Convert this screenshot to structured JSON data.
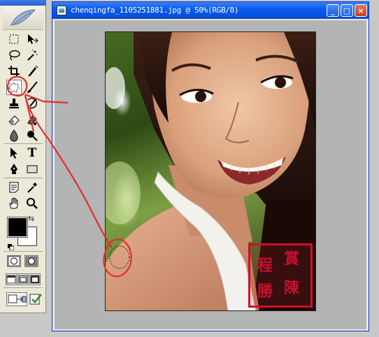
{
  "toolbox": {
    "tools": [
      {
        "name": "marquee-tool",
        "icon": "marquee-icon"
      },
      {
        "name": "move-tool",
        "icon": "move-icon"
      },
      {
        "name": "lasso-tool",
        "icon": "lasso-icon"
      },
      {
        "name": "magic-wand-tool",
        "icon": "magic-wand-icon"
      },
      {
        "name": "crop-tool",
        "icon": "crop-icon"
      },
      {
        "name": "slice-tool",
        "icon": "slice-icon"
      },
      {
        "name": "healing-tool",
        "icon": "healing-brush-icon"
      },
      {
        "name": "brush-tool",
        "icon": "brush-icon"
      },
      {
        "name": "clone-stamp-tool",
        "icon": "clone-stamp-icon"
      },
      {
        "name": "history-brush-tool",
        "icon": "history-brush-icon"
      },
      {
        "name": "eraser-tool",
        "icon": "eraser-icon"
      },
      {
        "name": "gradient-tool",
        "icon": "gradient-icon"
      },
      {
        "name": "blur-tool",
        "icon": "blur-icon"
      },
      {
        "name": "dodge-tool",
        "icon": "dodge-icon"
      },
      {
        "name": "path-selection-tool",
        "icon": "arrow-icon"
      },
      {
        "name": "type-tool",
        "icon": "type-icon",
        "label": "T"
      },
      {
        "name": "pen-tool",
        "icon": "pen-icon"
      },
      {
        "name": "shape-tool",
        "icon": "rectangle-icon"
      },
      {
        "name": "notes-tool",
        "icon": "notes-icon"
      },
      {
        "name": "eyedropper-tool",
        "icon": "eyedropper-icon"
      },
      {
        "name": "hand-tool",
        "icon": "hand-icon"
      },
      {
        "name": "zoom-tool",
        "icon": "magnifier-icon"
      }
    ],
    "foreground_color": "#000000",
    "background_color": "#ffffff"
  },
  "document": {
    "title": "chenqingfa_1105251881.jpg @ 50%(RGB/8)",
    "minimize_label": "_",
    "maximize_label": "□",
    "close_label": "×"
  },
  "photo": {
    "description_icon": "portrait-photo",
    "watermark_seal_text": [
      "賞",
      "陳",
      "程",
      "勝"
    ],
    "seal_color": "#d0102a"
  },
  "annotation": {
    "color": "#e0302e",
    "selection": "elliptical-marquee-dashed"
  }
}
